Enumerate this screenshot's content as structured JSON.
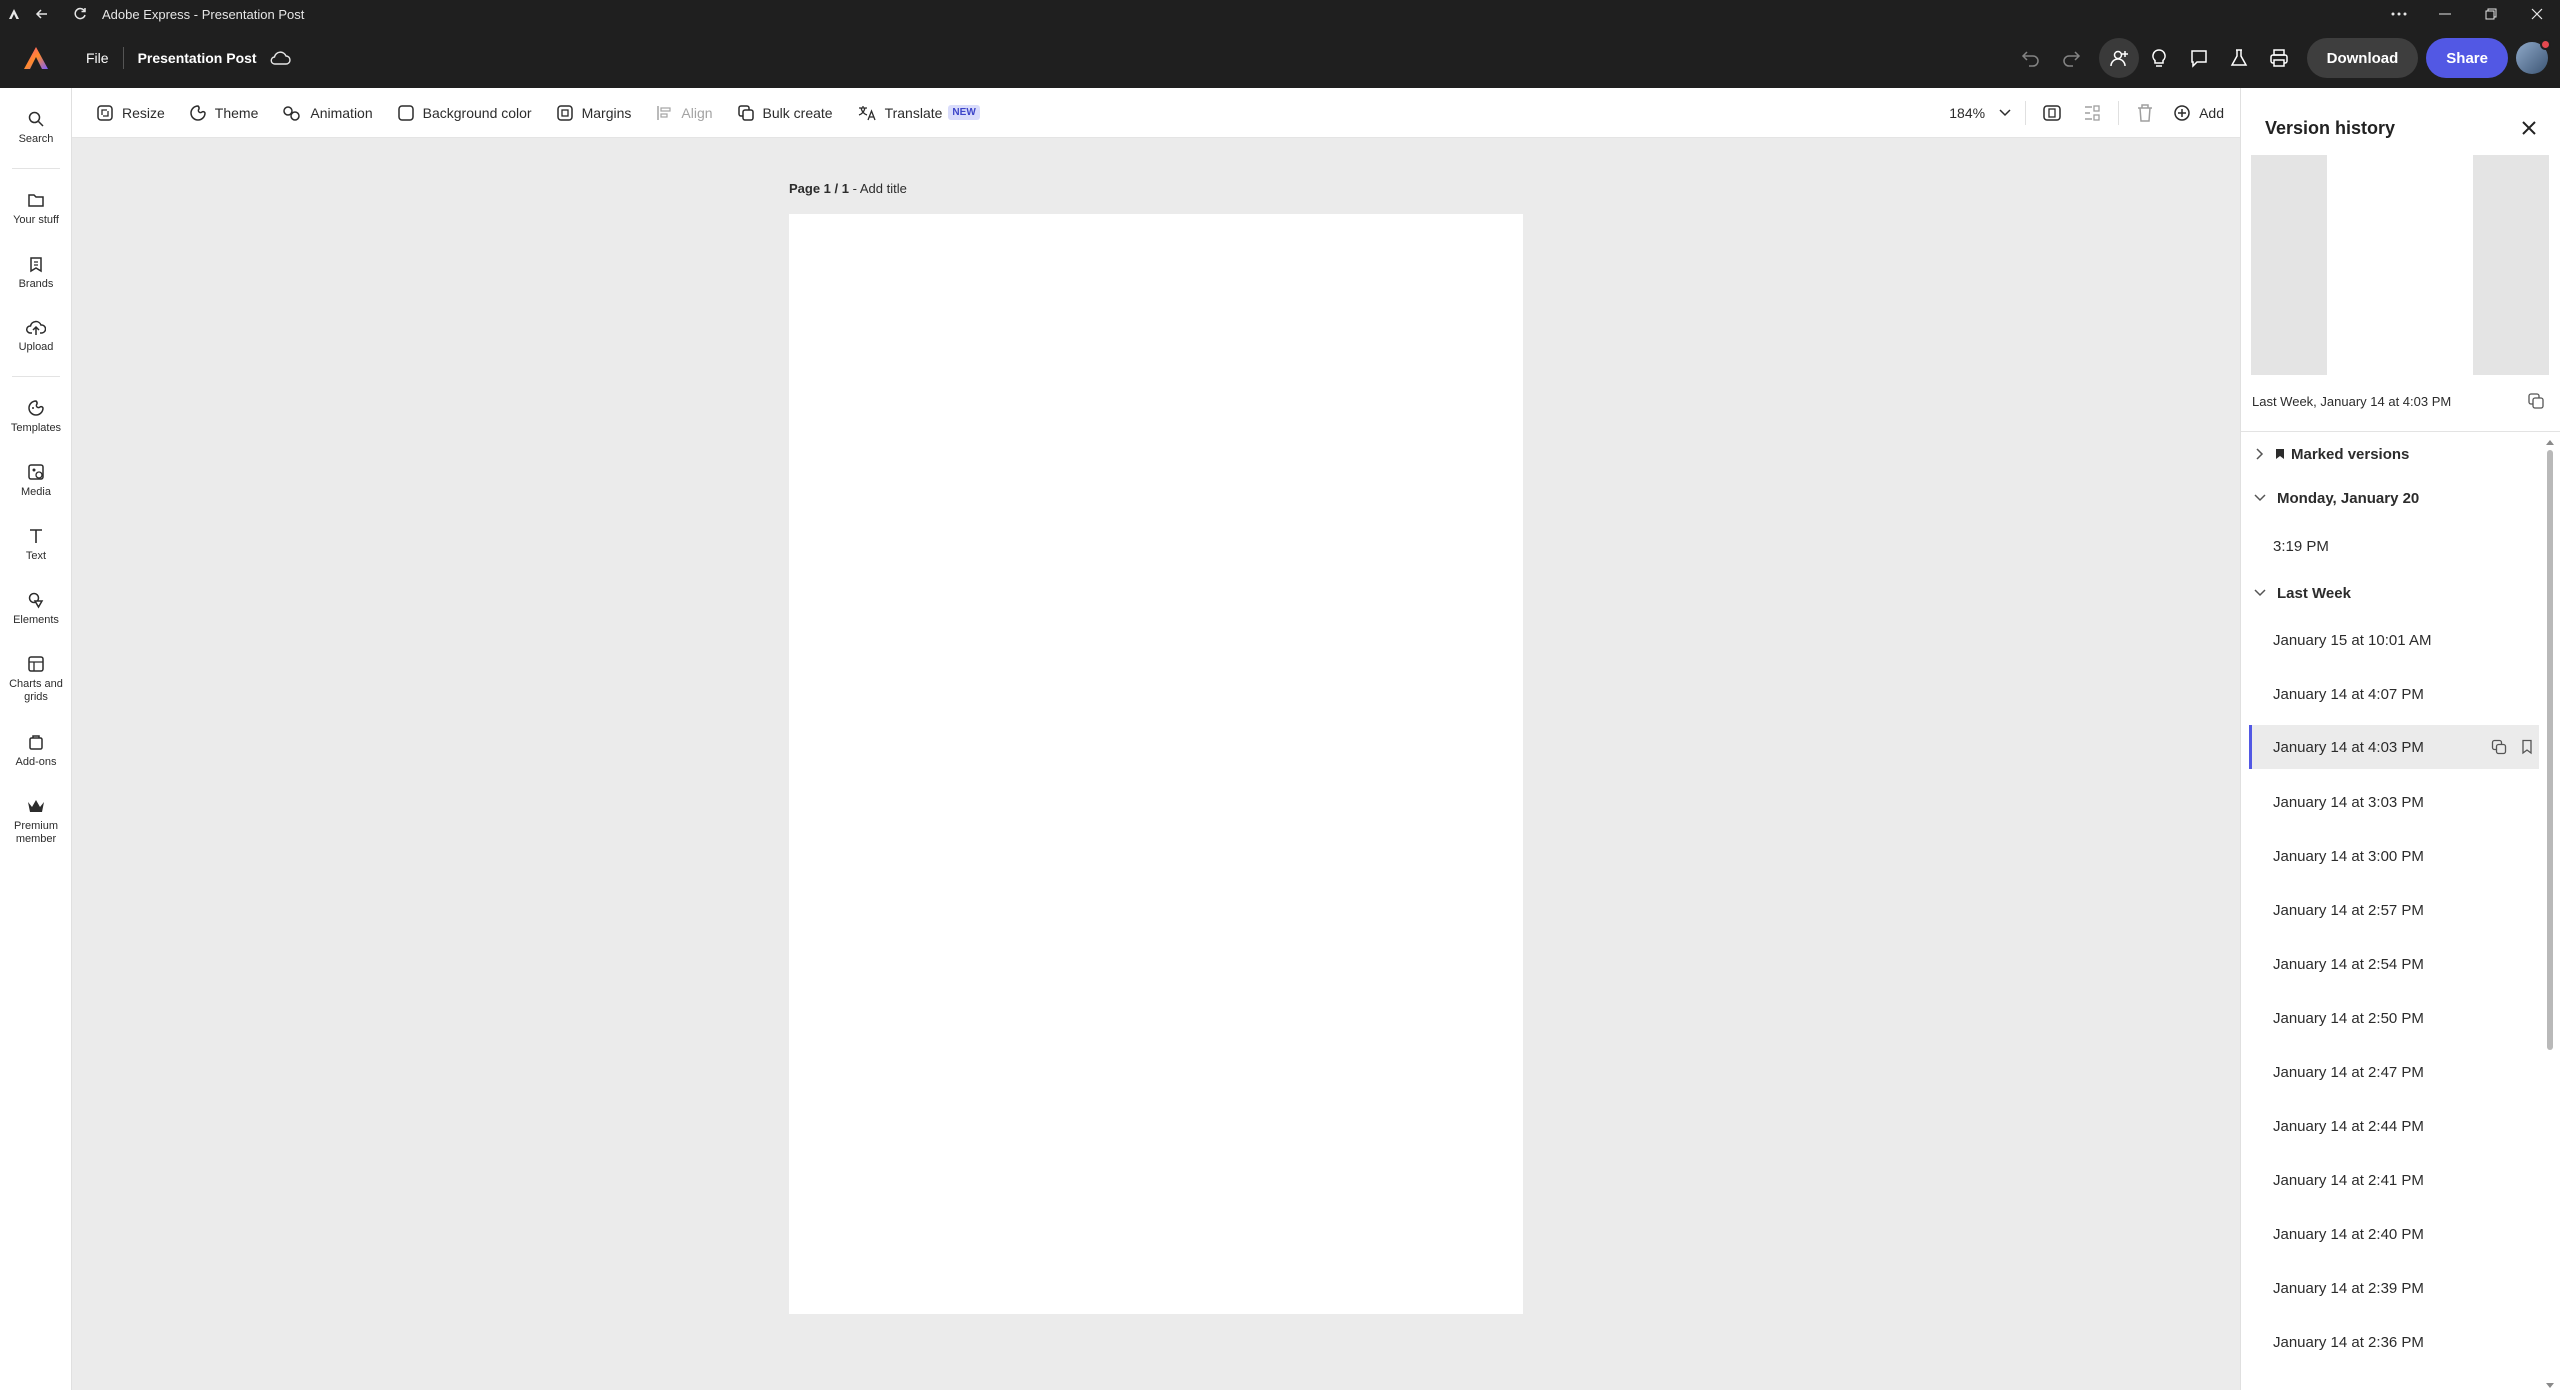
{
  "window": {
    "title": "Adobe Express - Presentation Post"
  },
  "header": {
    "file_label": "File",
    "doc_title": "Presentation Post",
    "download_label": "Download",
    "share_label": "Share"
  },
  "sidebar": {
    "items": [
      {
        "label": "Search",
        "icon": "search-icon"
      },
      {
        "label": "Your stuff",
        "icon": "folder-icon"
      },
      {
        "label": "Brands",
        "icon": "brand-icon"
      },
      {
        "label": "Upload",
        "icon": "upload-icon"
      },
      {
        "label": "Templates",
        "icon": "templates-icon"
      },
      {
        "label": "Media",
        "icon": "media-icon"
      },
      {
        "label": "Text",
        "icon": "text-icon"
      },
      {
        "label": "Elements",
        "icon": "elements-icon"
      },
      {
        "label": "Charts and grids",
        "icon": "charts-icon"
      },
      {
        "label": "Add-ons",
        "icon": "add-ons-icon"
      },
      {
        "label": "Premium member",
        "icon": "premium-icon"
      }
    ]
  },
  "toolbar": {
    "resize": "Resize",
    "theme": "Theme",
    "animation": "Animation",
    "background_color": "Background color",
    "margins": "Margins",
    "align": "Align",
    "bulk_create": "Bulk create",
    "translate": "Translate",
    "translate_badge": "NEW",
    "zoom": "184%",
    "add": "Add"
  },
  "canvas": {
    "page_indicator": "Page 1 / 1",
    "title_placeholder": "- Add title"
  },
  "version_history": {
    "title": "Version history",
    "selected_caption": "Last Week, January 14 at 4:03 PM",
    "groups": {
      "marked": "Marked versions",
      "monday": "Monday, January 20",
      "last_week": "Last Week"
    },
    "monday_versions": [
      "3:19 PM"
    ],
    "last_week_versions": [
      "January 15 at 10:01 AM",
      "January 14 at 4:07 PM",
      "January 14 at 4:03 PM",
      "January 14 at 3:03 PM",
      "January 14 at 3:00 PM",
      "January 14 at 2:57 PM",
      "January 14 at 2:54 PM",
      "January 14 at 2:50 PM",
      "January 14 at 2:47 PM",
      "January 14 at 2:44 PM",
      "January 14 at 2:41 PM",
      "January 14 at 2:40 PM",
      "January 14 at 2:39 PM",
      "January 14 at 2:36 PM"
    ]
  },
  "colors": {
    "accent": "#5258e4",
    "chrome": "#1f1f1f",
    "canvas_bg": "#ebebeb"
  }
}
